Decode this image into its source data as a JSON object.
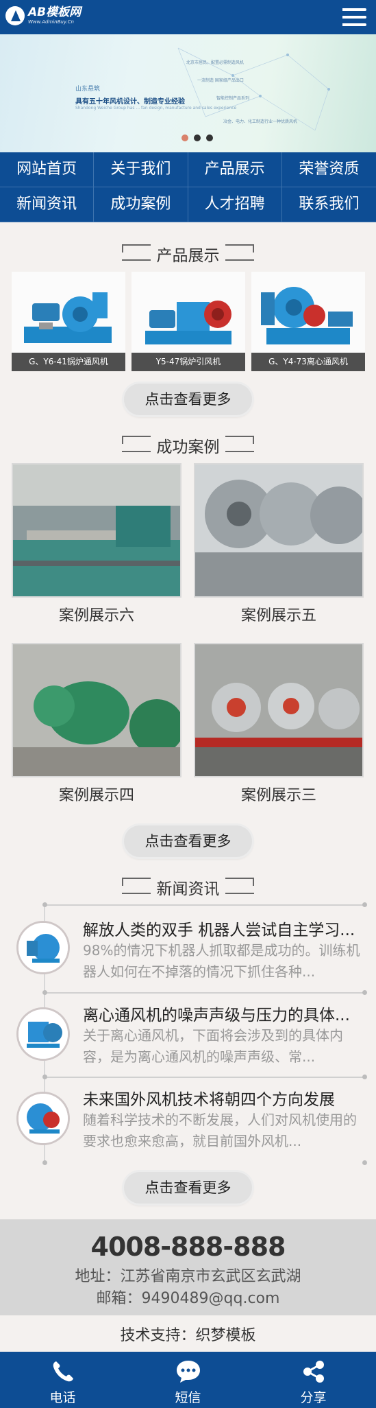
{
  "header": {
    "logo_title": "AB模板网",
    "logo_sub": "Www.AdminBuy.Cn",
    "menu_icon": "hamburger-menu-icon"
  },
  "banner": {
    "tag": "山东悬筑",
    "slogan": "具有五十年风机设计、制造专业经验",
    "small_text": "Shandong Weiche Group has ... fan design, manufacture and sales experience",
    "notes": [
      "北京市居民，配置必需制造风机",
      "一流制造 国家级产品出口",
      "智能控制产品系列",
      "冶金、电力、化工制造行业一种优质风机"
    ],
    "active_slide": 1,
    "slide_count": 3
  },
  "nav": {
    "items": [
      "网站首页",
      "关于我们",
      "产品展示",
      "荣誉资质",
      "新闻资讯",
      "成功案例",
      "人才招聘",
      "联系我们"
    ]
  },
  "products": {
    "title": "产品展示",
    "items": [
      {
        "caption": "G、Y6-41锅炉通风机"
      },
      {
        "caption": "Y5-47锅炉引风机"
      },
      {
        "caption": "G、Y4-73离心通风机"
      }
    ],
    "more": "点击查看更多"
  },
  "cases": {
    "title": "成功案例",
    "items": [
      {
        "caption": "案例展示六"
      },
      {
        "caption": "案例展示五"
      },
      {
        "caption": "案例展示四"
      },
      {
        "caption": "案例展示三"
      }
    ],
    "more": "点击查看更多"
  },
  "news": {
    "title": "新闻资讯",
    "items": [
      {
        "title": "解放人类的双手 机器人尝试自主学习...",
        "desc": "98%的情况下机器人抓取都是成功的。训练机器人如何在不掉落的情况下抓住各种..."
      },
      {
        "title": "离心通风机的噪声声级与压力的具体...",
        "desc": "关于离心通风机，下面将会涉及到的具体内容，是为离心通风机的噪声声级、常..."
      },
      {
        "title": "未来国外风机技术将朝四个方向发展",
        "desc": "随着科学技术的不断发展，人们对风机使用的要求也愈来愈高，就目前国外风机..."
      }
    ],
    "more": "点击查看更多"
  },
  "contact": {
    "phone": "4008-888-888",
    "address": "地址：江苏省南京市玄武区玄武湖",
    "email": "邮箱：9490489@qq.com"
  },
  "support": "技术支持：织梦模板",
  "bottom_bar": [
    {
      "label": "电话",
      "icon": "phone-icon"
    },
    {
      "label": "短信",
      "icon": "message-icon"
    },
    {
      "label": "分享",
      "icon": "share-icon"
    }
  ],
  "colors": {
    "brand": "#0d4d94",
    "background": "#f4f1ef"
  }
}
